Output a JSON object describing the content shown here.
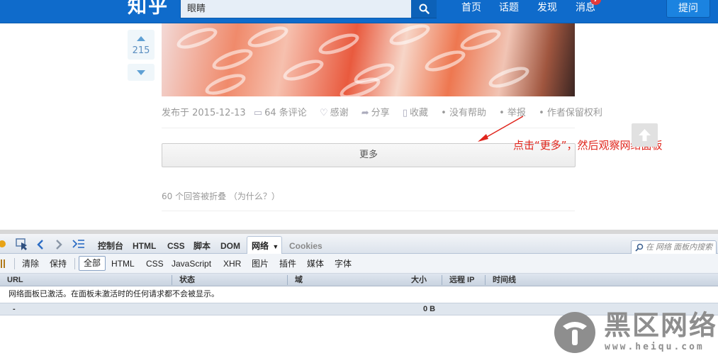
{
  "header": {
    "logo": "知乎",
    "search_value": "眼睛",
    "nav": [
      "首页",
      "话题",
      "发现",
      "消息"
    ],
    "badge_count": "7",
    "ask_label": "提问",
    "accent_color": "#0f6bcb"
  },
  "answer": {
    "vote_count": "215",
    "meta": {
      "published": "发布于 2015-12-13",
      "comments": "64 条评论",
      "thanks": "感谢",
      "share": "分享",
      "collect": "收藏",
      "unhelpful": "没有帮助",
      "report": "举报",
      "copyright": "作者保留权利"
    },
    "more_label": "更多",
    "folded_text": "60 个回答被折叠 （为什么？）"
  },
  "annotation": {
    "text": "点击“更多”，然后观察网络面板",
    "color": "#e0251c"
  },
  "devtools": {
    "tabs": [
      "控制台",
      "HTML",
      "CSS",
      "脚本",
      "DOM",
      "网络",
      "Cookies"
    ],
    "active_tab": "网络",
    "search_placeholder": "在 网络 面板内搜索",
    "filter_actions": [
      "清除",
      "保持"
    ],
    "filters": [
      "全部",
      "HTML",
      "CSS",
      "JavaScript",
      "XHR",
      "图片",
      "插件",
      "媒体",
      "字体"
    ],
    "active_filter": "全部",
    "columns": [
      "URL",
      "状态",
      "域",
      "大小",
      "远程 IP",
      "时间线"
    ],
    "info_message": "网络面板已激活。在面板未激活时的任何请求都不会被显示。",
    "summary": {
      "count": "-",
      "size": "0 B"
    }
  },
  "watermark": {
    "text": "黑区网络",
    "url": "www.heiqu.com"
  }
}
